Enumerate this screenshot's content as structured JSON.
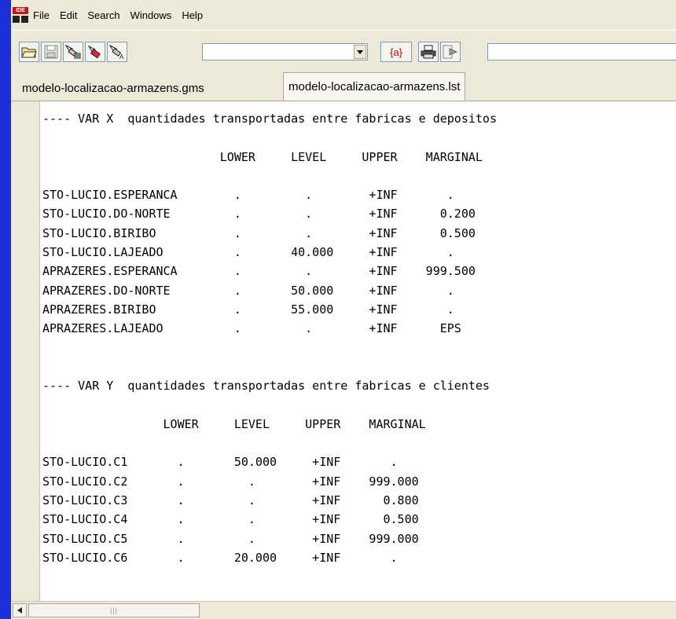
{
  "app": {
    "icon_label": "IDE"
  },
  "menu": [
    "File",
    "Edit",
    "Search",
    "Windows",
    "Help"
  ],
  "toolbar": {
    "buttons": [
      "open-icon",
      "save-icon",
      "flashlight-icon",
      "flashlight-icon",
      "flashlight-icon",
      "dropdown-icon",
      "model-library-icon",
      "print-icon",
      "run-icon"
    ],
    "model_button_label": "{a}",
    "model_combo_value": "",
    "command_field_value": ""
  },
  "tabs": [
    {
      "label": "modelo-localizacao-armazens.gms",
      "active": false
    },
    {
      "label": "modelo-localizacao-armazens.lst",
      "active": true
    }
  ],
  "listing": {
    "lines": [
      "---- VAR X  quantidades transportadas entre fabricas e depositos",
      "",
      "                         LOWER     LEVEL     UPPER    MARGINAL",
      "",
      "STO-LUCIO.ESPERANCA        .         .        +INF       .",
      "STO-LUCIO.DO-NORTE         .         .        +INF      0.200",
      "STO-LUCIO.BIRIBO           .         .        +INF      0.500",
      "STO-LUCIO.LAJEADO          .       40.000     +INF       .",
      "APRAZERES.ESPERANCA        .         .        +INF    999.500",
      "APRAZERES.DO-NORTE         .       50.000     +INF       .",
      "APRAZERES.BIRIBO           .       55.000     +INF       .",
      "APRAZERES.LAJEADO          .         .        +INF      EPS",
      "",
      "",
      "---- VAR Y  quantidades transportadas entre fabricas e clientes",
      "",
      "                 LOWER     LEVEL     UPPER    MARGINAL",
      "",
      "STO-LUCIO.C1       .       50.000     +INF       .",
      "STO-LUCIO.C2       .         .        +INF    999.000",
      "STO-LUCIO.C3       .         .        +INF      0.800",
      "STO-LUCIO.C4       .         .        +INF      0.500",
      "STO-LUCIO.C5       .         .        +INF    999.000",
      "STO-LUCIO.C6       .       20.000     +INF       ."
    ]
  },
  "scrollbar": {
    "left_arrow": "◄",
    "thumb_grip": "|||"
  },
  "colors": {
    "desktop": "#1a2fd8",
    "chrome": "#ece9d8",
    "border": "#7f9db9"
  }
}
